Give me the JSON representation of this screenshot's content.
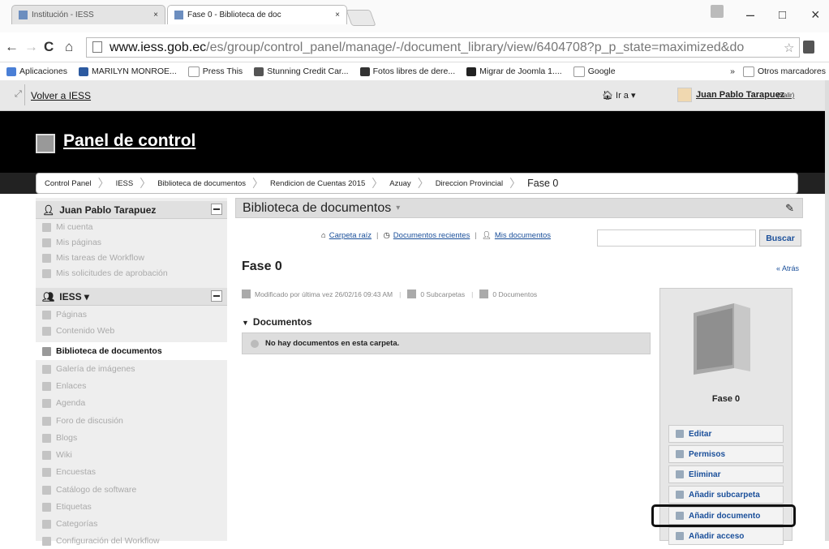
{
  "browser": {
    "tabs": [
      {
        "label": "Institución - IESS",
        "close": "×"
      },
      {
        "label": "Fase 0 - Biblioteca de doc",
        "close": "×"
      }
    ],
    "window_controls": {
      "minimize": "–",
      "maximize": "□",
      "close": "×"
    },
    "url_host": "www.iess.gob.ec",
    "url_path": "/es/group/control_panel/manage/-/document_library/view/6404708?p_p_state=maximized&do",
    "bookmarks": [
      {
        "label": "Aplicaciones",
        "color": "#4a7fd6"
      },
      {
        "label": "MARILYN MONROE...",
        "color": "#2c5aa0"
      },
      {
        "label": "Press This",
        "color": "#999999"
      },
      {
        "label": "Stunning Credit Car...",
        "color": "#555555"
      },
      {
        "label": "Fotos libres de dere...",
        "color": "#333333"
      },
      {
        "label": "Migrar de Joomla 1....",
        "color": "#222222"
      },
      {
        "label": "Google",
        "color": "#4285f4"
      }
    ],
    "bookmarks_more": "»",
    "other_bookmarks": "Otros marcadores"
  },
  "dockbar": {
    "back_link": "Volver a IESS",
    "goto": "Ir a ▾",
    "user_name": "Juan Pablo Tarapuez",
    "logout": "(Salir)"
  },
  "header": {
    "title": "Panel de control"
  },
  "breadcrumb": [
    "Control Panel",
    "IESS",
    "Biblioteca de documentos",
    "Rendicion de Cuentas 2015",
    "Azuay",
    "Direccion Provincial",
    "Fase 0"
  ],
  "sidebar": {
    "user_section": {
      "title": "Juan Pablo Tarapuez",
      "items": [
        "Mi cuenta",
        "Mis páginas",
        "Mis tareas de Workflow",
        "Mis solicitudes de aprobación"
      ]
    },
    "site_section": {
      "title": "IESS ▾",
      "items": [
        "Páginas",
        "Contenido Web",
        "Biblioteca de documentos",
        "Galería de imágenes",
        "Enlaces",
        "Agenda",
        "Foro de discusión",
        "Blogs",
        "Wiki",
        "Encuestas",
        "Catálogo de software",
        "Etiquetas",
        "Categorías",
        "Configuración del Workflow"
      ],
      "active_index": 2
    }
  },
  "main": {
    "portlet_title": "Biblioteca de documentos",
    "links": {
      "root": "Carpeta raíz",
      "recent": "Documentos recientes",
      "mine": "Mis documentos",
      "sep": "|"
    },
    "search_button": "Buscar",
    "folder_title": "Fase 0",
    "back": "« Atrás",
    "meta": {
      "modified": "Modificado por última vez 26/02/16 09:43 AM",
      "subfolders": "0 Subcarpetas",
      "documents": "0 Documentos"
    },
    "section_title": "Documentos",
    "empty_message": "No hay documentos en esta carpeta."
  },
  "right_panel": {
    "folder_name": "Fase 0",
    "actions": [
      "Editar",
      "Permisos",
      "Eliminar",
      "Añadir subcarpeta",
      "Añadir documento",
      "Añadir acceso"
    ]
  }
}
